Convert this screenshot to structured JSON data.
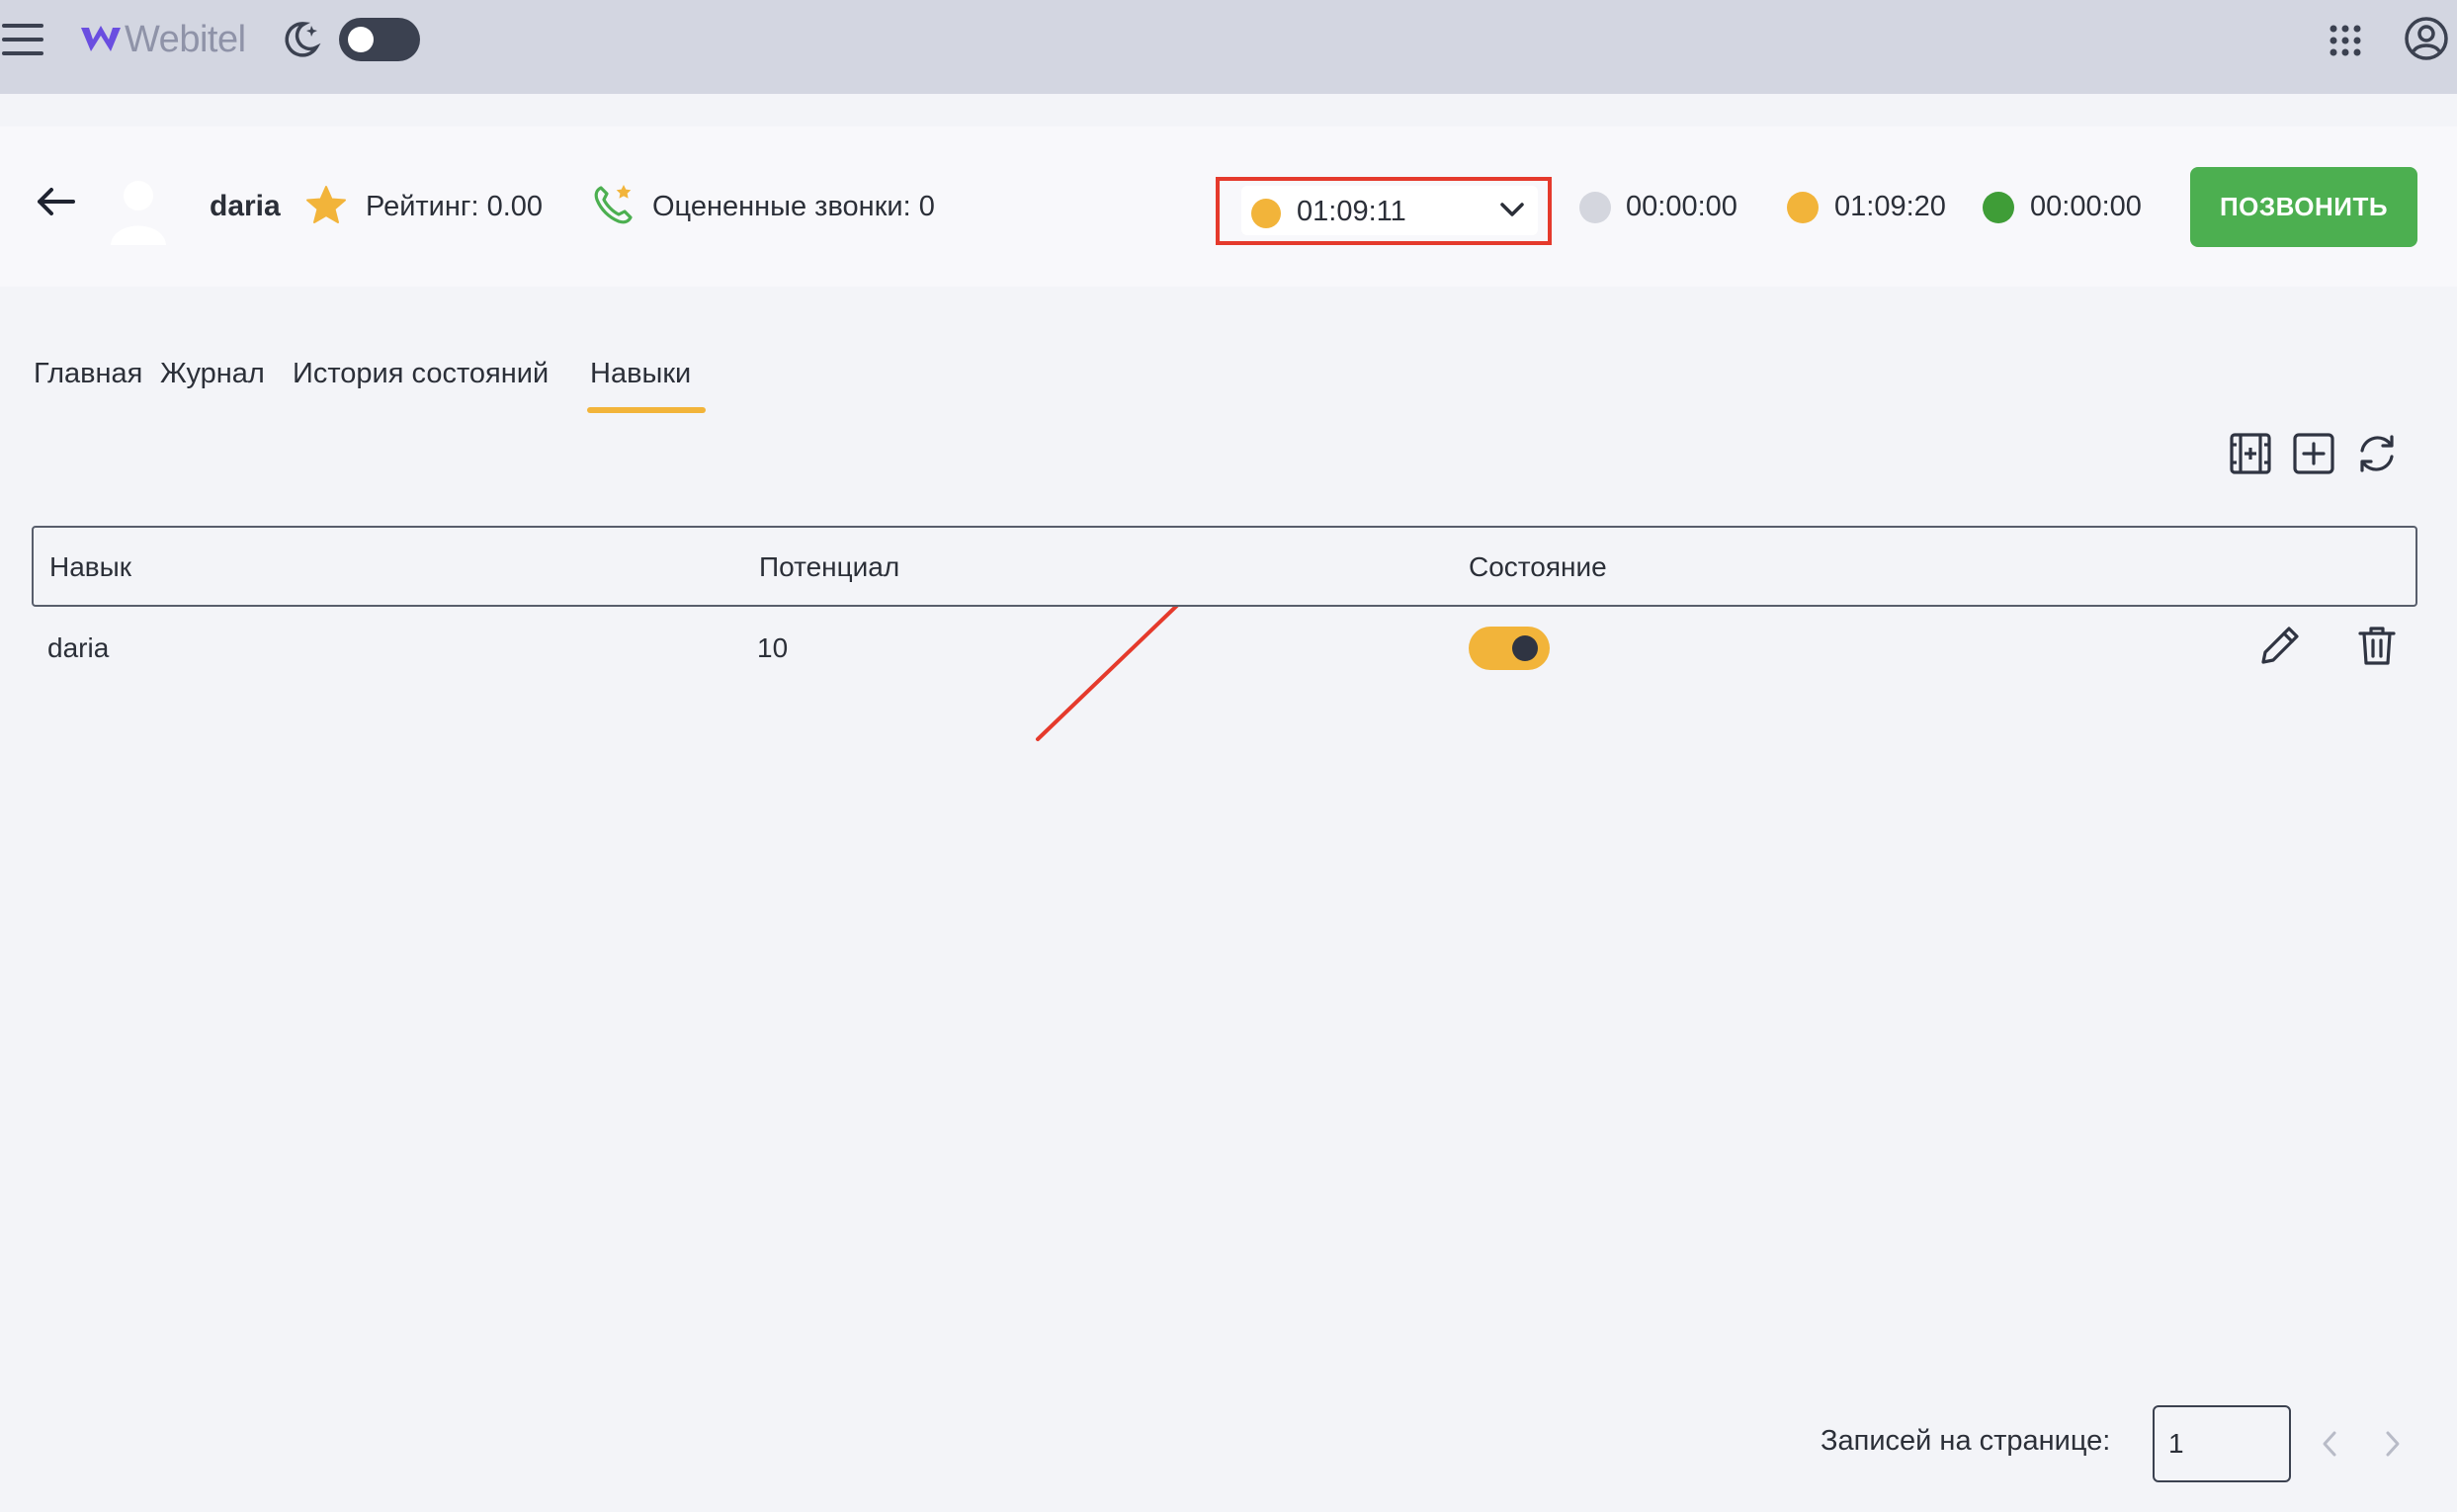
{
  "app": {
    "logo_text": "Webitel"
  },
  "agent": {
    "name": "daria",
    "rating": "Рейтинг: 0.00",
    "rated_calls": "Оцененные звонки: 0"
  },
  "status": {
    "selected_time": "01:09:11",
    "timers": [
      {
        "time": "00:00:00",
        "color": "#d4d6de"
      },
      {
        "time": "01:09:20",
        "color": "#f2b43a"
      },
      {
        "time": "00:00:00",
        "color": "#3f9d37"
      }
    ],
    "selected_color": "#f2b43a"
  },
  "call_button": "ПОЗВОНИТЬ",
  "tabs": [
    {
      "label": "Главная"
    },
    {
      "label": "Журнал"
    },
    {
      "label": "История состояний"
    },
    {
      "label": "Навыки",
      "active": true
    }
  ],
  "table": {
    "columns": [
      "Навык",
      "Потенциал",
      "Состояние"
    ],
    "rows": [
      {
        "skill": "daria",
        "potential": "10",
        "state_on": true
      }
    ]
  },
  "pagination": {
    "per_page_label": "Записей на странице:",
    "per_page_value": "1"
  },
  "colors": {
    "accent": "#f2b43a",
    "success": "#4caf50",
    "highlight": "#e53a2c"
  }
}
